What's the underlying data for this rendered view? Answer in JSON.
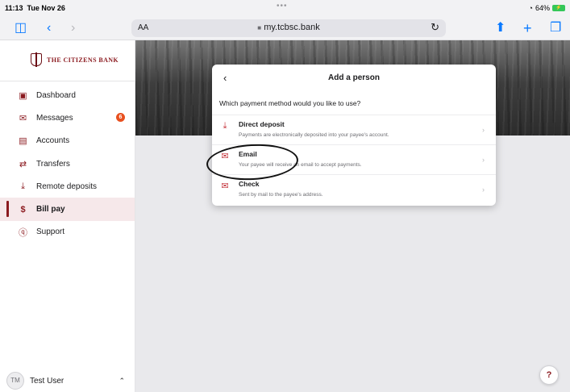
{
  "status_bar": {
    "time": "11:13",
    "date": "Tue Nov 26",
    "dots": "•••",
    "battery_percent": "64%"
  },
  "browser": {
    "aa_label": "AA",
    "url": "my.tcbsc.bank"
  },
  "sidebar": {
    "logo_text": "THE CITIZENS BANK",
    "items": [
      {
        "label": "Dashboard",
        "icon": "dashboard-icon"
      },
      {
        "label": "Messages",
        "icon": "envelope-icon",
        "badge": "6"
      },
      {
        "label": "Accounts",
        "icon": "wallet-icon"
      },
      {
        "label": "Transfers",
        "icon": "transfer-arrows-icon"
      },
      {
        "label": "Remote deposits",
        "icon": "download-tray-icon"
      },
      {
        "label": "Bill pay",
        "icon": "dollar-document-icon",
        "active": true
      },
      {
        "label": "Support",
        "icon": "question-circle-icon"
      }
    ],
    "user": {
      "initials": "TM",
      "name": "Test User"
    }
  },
  "dialog": {
    "title": "Add a person",
    "question": "Which payment method would you like to use?",
    "options": [
      {
        "title": "Direct deposit",
        "description": "Payments are electronically deposited into your payee's account.",
        "icon": "download-tray-icon"
      },
      {
        "title": "Email",
        "description": "Your payee will receive an email to accept payments.",
        "icon": "envelope-icon"
      },
      {
        "title": "Check",
        "description": "Sent by mail to the payee's address.",
        "icon": "envelope-icon"
      }
    ]
  },
  "help_button": {
    "label": "?"
  },
  "colors": {
    "brand": "#8b1a1f",
    "accent_icon": "#c4323a",
    "active_bg": "#f6e8ea",
    "badge": "#e8501f",
    "safari_blue": "#0a7aff"
  }
}
